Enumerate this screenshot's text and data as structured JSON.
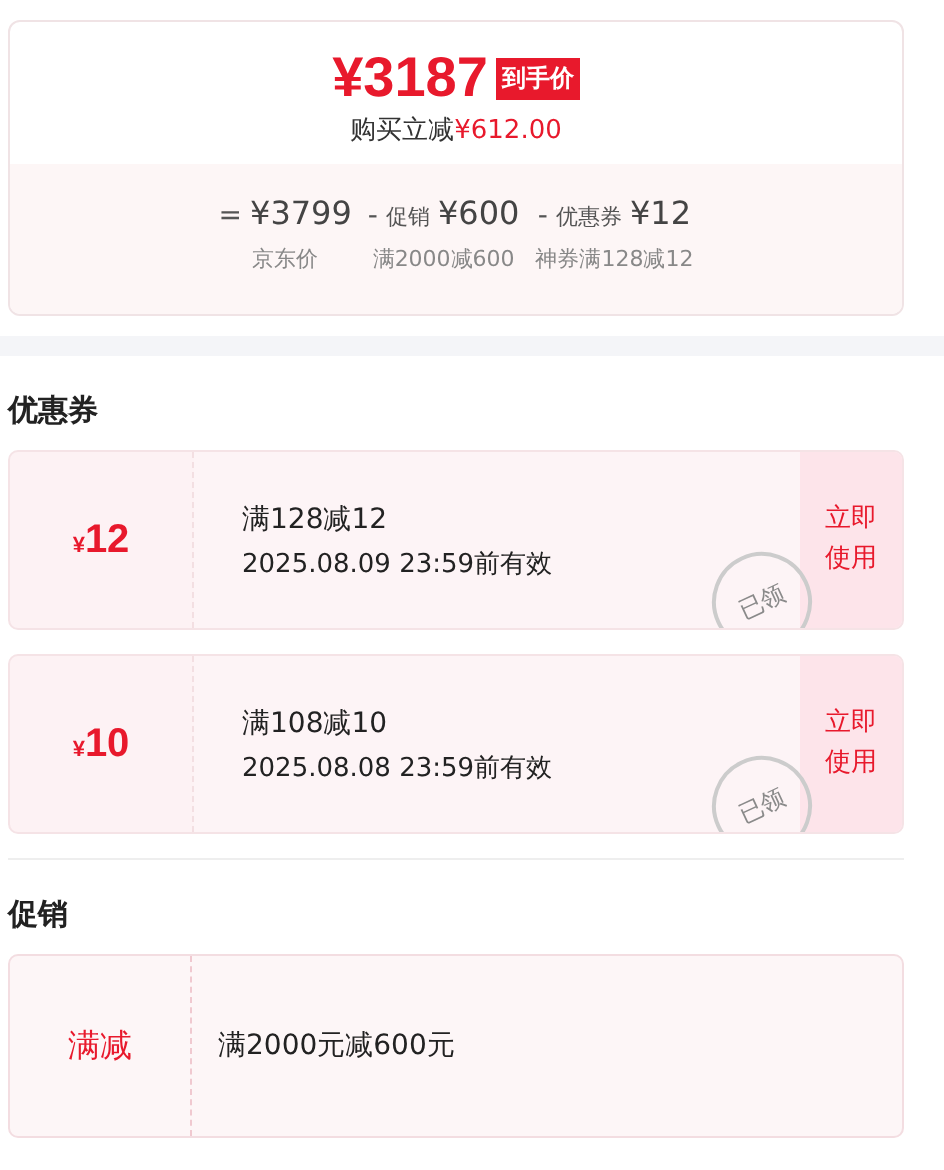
{
  "price_card": {
    "price": "¥3187",
    "price_tag": "到手价",
    "saving_label": "购买立减",
    "saving_amount": "¥612.00",
    "breakdown": [
      {
        "operator": "=",
        "amount": "¥3799",
        "note": "京东价"
      },
      {
        "operator": "-",
        "label": "促销",
        "amount": "¥600",
        "note": "满2000减600"
      },
      {
        "operator": "-",
        "label": "优惠券",
        "amount": "¥12",
        "note": "神券满128减12"
      }
    ]
  },
  "coupons_section": {
    "title": "优惠券",
    "coupons": [
      {
        "symbol": "¥",
        "value": "12",
        "condition": "满128减12",
        "validity": "2025.08.09 23:59前有效",
        "claimed": true,
        "stamp": "已领",
        "action": "立即使用"
      },
      {
        "symbol": "¥",
        "value": "10",
        "condition": "满108减10",
        "validity": "2025.08.08 23:59前有效",
        "claimed": true,
        "stamp": "已领",
        "action": "立即使用"
      }
    ]
  },
  "promotions_section": {
    "title": "促销",
    "promotions": [
      {
        "tag": "满减",
        "description": "满2000元减600元"
      }
    ]
  }
}
